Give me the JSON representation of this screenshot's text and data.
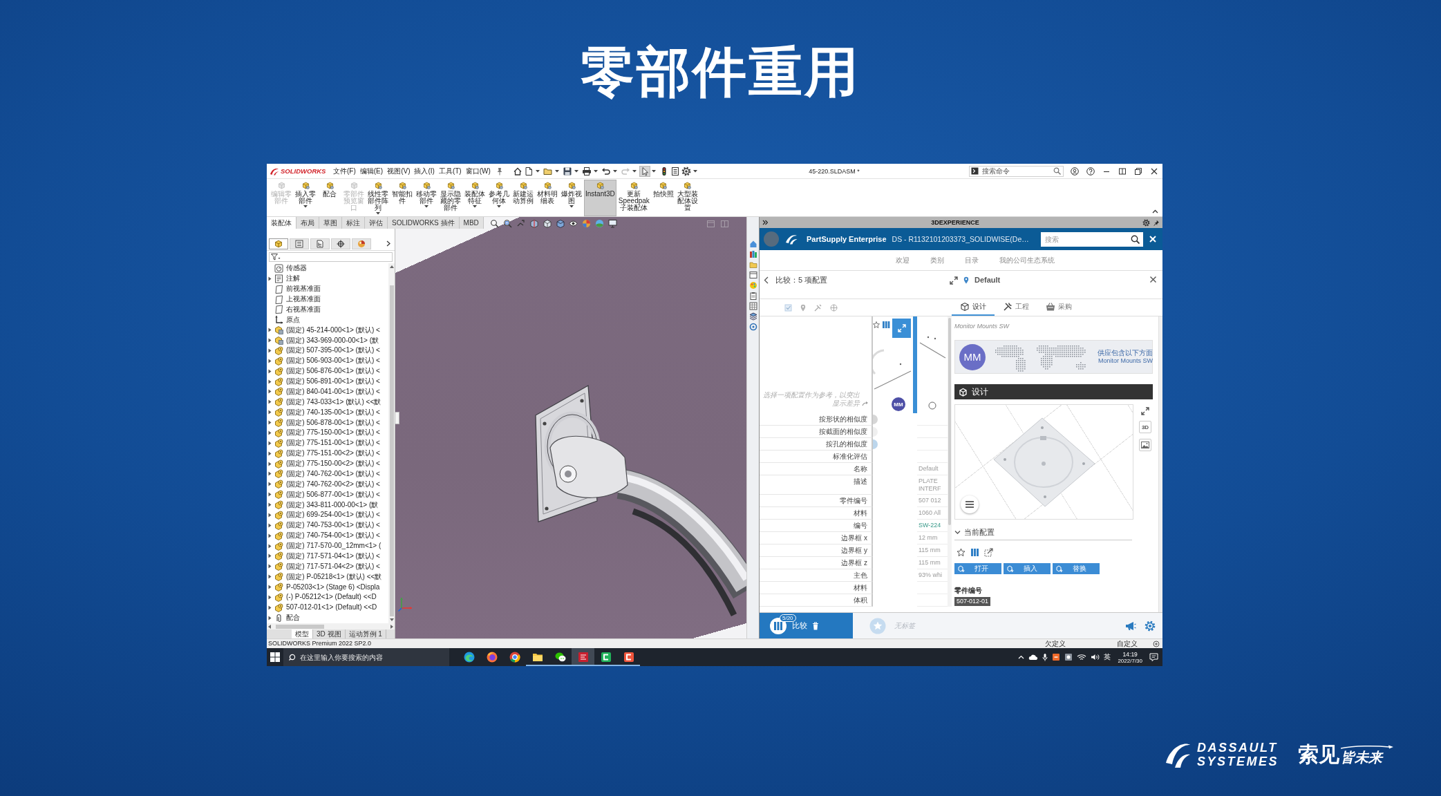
{
  "slide": {
    "title": "零部件重用"
  },
  "app_window": {
    "logo": "SOLIDWORKS",
    "menus": [
      "文件(F)",
      "编辑(E)",
      "视图(V)",
      "插入(I)",
      "工具(T)",
      "窗口(W)"
    ],
    "toolbar": [
      {
        "kind": "home",
        "selected": false,
        "dropdown": false,
        "disabled": false
      },
      {
        "kind": "new",
        "selected": false,
        "dropdown": true,
        "disabled": false
      },
      {
        "kind": "open",
        "selected": false,
        "dropdown": true,
        "disabled": false
      },
      {
        "kind": "save",
        "selected": false,
        "dropdown": true,
        "disabled": false
      },
      {
        "kind": "print",
        "selected": false,
        "dropdown": true,
        "disabled": false
      },
      {
        "kind": "undo",
        "selected": false,
        "dropdown": true,
        "disabled": false
      },
      {
        "kind": "redo",
        "selected": false,
        "dropdown": true,
        "disabled": true
      },
      {
        "kind": "select",
        "selected": true,
        "dropdown": true,
        "disabled": false
      },
      {
        "kind": "rebuild",
        "selected": false,
        "dropdown": false,
        "disabled": false
      },
      {
        "kind": "properties",
        "selected": false,
        "dropdown": false,
        "disabled": false
      },
      {
        "kind": "options",
        "selected": false,
        "dropdown": true,
        "disabled": false
      }
    ],
    "document_title": "45-220.SLDASM *",
    "command_search": {
      "placeholder": "搜索命令"
    },
    "ribbon": [
      {
        "label": "编辑零部件",
        "disabled": true,
        "selected": false,
        "dropdown": false
      },
      {
        "label": "插入零部件",
        "disabled": false,
        "selected": false,
        "dropdown": true
      },
      {
        "label": "配合",
        "disabled": false,
        "selected": false,
        "dropdown": false
      },
      {
        "label": "零部件预览窗口",
        "disabled": true,
        "selected": false,
        "dropdown": false
      },
      {
        "label": "线性零部件阵列",
        "disabled": false,
        "selected": false,
        "dropdown": true
      },
      {
        "label": "智能扣件",
        "disabled": false,
        "selected": false,
        "dropdown": false
      },
      {
        "label": "移动零部件",
        "disabled": false,
        "selected": false,
        "dropdown": true
      },
      {
        "label": "显示隐藏的零部件",
        "disabled": false,
        "selected": false,
        "dropdown": false
      },
      {
        "label": "装配体特征",
        "disabled": false,
        "selected": false,
        "dropdown": true
      },
      {
        "label": "参考几何体",
        "disabled": false,
        "selected": false,
        "dropdown": true
      },
      {
        "label": "新建运动算例",
        "disabled": false,
        "selected": false,
        "dropdown": false
      },
      {
        "label": "材料明细表",
        "disabled": false,
        "selected": false,
        "dropdown": false
      },
      {
        "label": "爆炸视图",
        "disabled": false,
        "selected": false,
        "dropdown": true
      },
      {
        "label": "Instant3D",
        "disabled": false,
        "selected": true,
        "dropdown": false
      },
      {
        "label": "更新Speedpak子装配体",
        "disabled": false,
        "selected": false,
        "dropdown": false
      },
      {
        "label": "拍快照",
        "disabled": false,
        "selected": false,
        "dropdown": false
      },
      {
        "label": "大型装配体设置",
        "disabled": false,
        "selected": false,
        "dropdown": false
      }
    ],
    "command_tabs": [
      {
        "label": "装配体",
        "selected": true
      },
      {
        "label": "布局",
        "selected": false
      },
      {
        "label": "草图",
        "selected": false
      },
      {
        "label": "标注",
        "selected": false
      },
      {
        "label": "评估",
        "selected": false
      },
      {
        "label": "SOLIDWORKS 插件",
        "selected": false
      },
      {
        "label": "MBD",
        "selected": false
      }
    ],
    "feature_tree": {
      "manager_tabs": [
        {
          "kind": "feature",
          "selected": true
        },
        {
          "kind": "property",
          "selected": false
        },
        {
          "kind": "configuration",
          "selected": false
        },
        {
          "kind": "dimxpert",
          "selected": false
        },
        {
          "kind": "display",
          "selected": false
        }
      ],
      "items": [
        {
          "kind": "sensor",
          "label": "传感器",
          "expandable": false
        },
        {
          "kind": "annotation",
          "label": "注解",
          "expandable": true
        },
        {
          "kind": "plane",
          "label": "前视基准面",
          "expandable": false
        },
        {
          "kind": "plane",
          "label": "上视基准面",
          "expandable": false
        },
        {
          "kind": "plane",
          "label": "右视基准面",
          "expandable": false
        },
        {
          "kind": "origin",
          "label": "原点",
          "expandable": false
        },
        {
          "kind": "assembly",
          "label": "(固定) 45-214-000<1> (默认) <",
          "expandable": true
        },
        {
          "kind": "assembly",
          "label": "(固定) 343-969-000-00<1> (默",
          "expandable": true
        },
        {
          "kind": "part",
          "label": "(固定) 507-395-00<1> (默认) <",
          "expandable": true
        },
        {
          "kind": "part",
          "label": "(固定) 506-903-00<1> (默认) <",
          "expandable": true
        },
        {
          "kind": "part",
          "label": "(固定) 506-876-00<1> (默认) <",
          "expandable": true
        },
        {
          "kind": "part",
          "label": "(固定) 506-891-00<1> (默认) <",
          "expandable": true
        },
        {
          "kind": "part",
          "label": "(固定) 840-041-00<1> (默认) <",
          "expandable": true
        },
        {
          "kind": "part",
          "label": "(固定) 743-033<1> (默认) <<默",
          "expandable": true
        },
        {
          "kind": "part",
          "label": "(固定) 740-135-00<1> (默认) <",
          "expandable": true
        },
        {
          "kind": "part",
          "label": "(固定) 506-878-00<1> (默认) <",
          "expandable": true
        },
        {
          "kind": "part",
          "label": "(固定) 775-150-00<1> (默认) <",
          "expandable": true
        },
        {
          "kind": "part",
          "label": "(固定) 775-151-00<1> (默认) <",
          "expandable": true
        },
        {
          "kind": "part",
          "label": "(固定) 775-151-00<2> (默认) <",
          "expandable": true
        },
        {
          "kind": "part",
          "label": "(固定) 775-150-00<2> (默认) <",
          "expandable": true
        },
        {
          "kind": "part",
          "label": "(固定) 740-762-00<1> (默认) <",
          "expandable": true
        },
        {
          "kind": "part",
          "label": "(固定) 740-762-00<2> (默认) <",
          "expandable": true
        },
        {
          "kind": "part",
          "label": "(固定) 506-877-00<1> (默认) <",
          "expandable": true
        },
        {
          "kind": "part",
          "label": "(固定) 343-811-000-00<1> (默",
          "expandable": true
        },
        {
          "kind": "part",
          "label": "(固定) 699-254-00<1> (默认) <",
          "expandable": true
        },
        {
          "kind": "part",
          "label": "(固定) 740-753-00<1> (默认) <",
          "expandable": true
        },
        {
          "kind": "part",
          "label": "(固定) 740-754-00<1> (默认) <",
          "expandable": true
        },
        {
          "kind": "part",
          "label": "(固定) 717-570-00_12mm<1> (",
          "expandable": true
        },
        {
          "kind": "part",
          "label": "(固定) 717-571-04<1> (默认) <",
          "expandable": true
        },
        {
          "kind": "part",
          "label": "(固定) 717-571-04<2> (默认) <",
          "expandable": true
        },
        {
          "kind": "part",
          "label": "(固定) P-05218<1> (默认) <<默",
          "expandable": true
        },
        {
          "kind": "part",
          "label": "P-05203<1> (Stage 6) <Displa",
          "expandable": true
        },
        {
          "kind": "part",
          "label": "(-) P-05212<1> (Default) <<D",
          "expandable": true
        },
        {
          "kind": "part",
          "label": "507-012-01<1> (Default) <<D",
          "expandable": true
        },
        {
          "kind": "mates",
          "label": "配合",
          "expandable": true
        }
      ],
      "tabs": [
        {
          "label": "模型",
          "selected": true
        },
        {
          "label": "3D 视图",
          "selected": false
        },
        {
          "label": "运动算例 1",
          "selected": false
        }
      ]
    },
    "status_bar": {
      "product": "SOLIDWORKS Premium 2022 SP2.0",
      "definition": "欠定义",
      "units": "自定义"
    }
  },
  "experience_panel": {
    "title": "3DEXPERIENCE",
    "app": "PartSupply Enterprise",
    "tenant": "DS - R1132101203373_SOLIDWISE(De…",
    "search": {
      "placeholder": "搜索"
    },
    "nav": [
      "欢迎",
      "类别",
      "目录",
      "我的公司生态系统"
    ],
    "compare_title": "比较：5 项配置",
    "reference": "Default",
    "tabs": [
      {
        "kind": "design",
        "label": "设计",
        "selected": true
      },
      {
        "kind": "engineering",
        "label": "工程",
        "selected": false
      },
      {
        "kind": "procurement",
        "label": "采购",
        "selected": false
      }
    ],
    "card": {
      "badge": "MM"
    },
    "reference_radio": {
      "selected": false
    },
    "hint": "选择一项配置作为参考，以突出显示差异",
    "rows": [
      {
        "kind": "similarity",
        "label": "按形状的相似度",
        "color": "#d6d6d6"
      },
      {
        "kind": "similarity",
        "label": "按截面的相似度",
        "color": "#efefef"
      },
      {
        "kind": "similarity",
        "label": "按孔的相似度",
        "color": "#bcd6ec"
      },
      {
        "kind": "text",
        "label": "标准化评估"
      },
      {
        "kind": "text",
        "label": "名称",
        "value": "Default"
      },
      {
        "kind": "text",
        "label": "描述",
        "value": "PLATE INTERF"
      },
      {
        "kind": "text",
        "label": "零件编号",
        "value": "507 012"
      },
      {
        "kind": "text",
        "label": "材料",
        "value": "1060 All"
      },
      {
        "kind": "link",
        "label": "编号",
        "value": "SW-224"
      },
      {
        "kind": "text",
        "label": "边界框 x",
        "value": "12 mm"
      },
      {
        "kind": "text",
        "label": "边界框 y",
        "value": "115 mm"
      },
      {
        "kind": "text",
        "label": "边界框 z",
        "value": "115 mm"
      },
      {
        "kind": "text",
        "label": "主色",
        "value": "93% whi"
      },
      {
        "kind": "text",
        "label": "材料"
      },
      {
        "kind": "text",
        "label": "体积"
      }
    ],
    "supplier": "Monitor Mounts SW",
    "banner": {
      "logo": "MM",
      "lines": [
        "供应包含以下方面",
        "Monitor Mounts SW"
      ]
    },
    "section": "设计",
    "preview_mode": "3D",
    "current_config": {
      "title": "当前配置",
      "expanded": true
    },
    "actions": [
      "打开",
      "插入",
      "替换"
    ],
    "part_number": {
      "label": "零件编号",
      "value": "507-012-01"
    },
    "compare": {
      "count": "5/20",
      "label": "比较"
    },
    "tags": {
      "placeholder": "无标签"
    }
  },
  "taskbar": {
    "search": {
      "placeholder": "在这里输入你要搜索的内容"
    },
    "apps": [
      {
        "kind": "edge",
        "running": false,
        "selected": false
      },
      {
        "kind": "firefox",
        "running": false,
        "selected": false
      },
      {
        "kind": "chrome",
        "running": false,
        "selected": false
      },
      {
        "kind": "explorer",
        "running": true,
        "selected": false
      },
      {
        "kind": "wechat",
        "running": true,
        "selected": false
      },
      {
        "kind": "cad",
        "running": true,
        "selected": true
      },
      {
        "kind": "greenc",
        "running": true,
        "selected": false
      },
      {
        "kind": "redc",
        "running": true,
        "selected": false
      }
    ],
    "input_method": "英",
    "time": "14:19",
    "date": "2022/7/30"
  },
  "branding": {
    "company": [
      "DASSAULT",
      "SYSTEMES"
    ],
    "slogan": [
      "索见",
      "皆未来"
    ]
  }
}
